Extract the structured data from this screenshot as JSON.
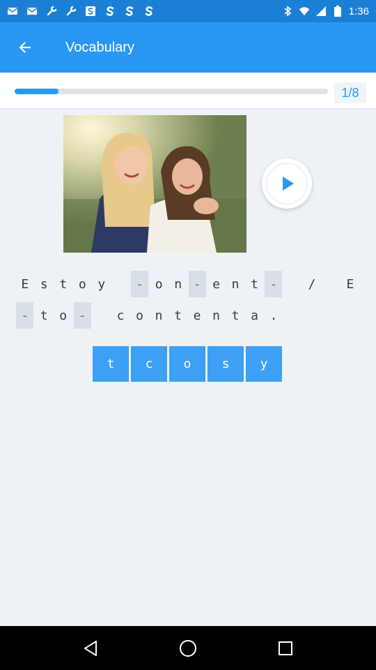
{
  "status_bar": {
    "time": "1:36",
    "icons": [
      "mail-icon",
      "mail-icon",
      "wrench-icon",
      "wrench-icon",
      "s-app-icon",
      "s-app-icon",
      "s-app-icon",
      "s-app-icon"
    ]
  },
  "app_bar": {
    "title": "Vocabulary",
    "back_icon": "arrow-back-icon"
  },
  "progress": {
    "fraction": 0.14,
    "counter": "1/8"
  },
  "media": {
    "photo_alt": "",
    "play_icon": "play-icon"
  },
  "sentence": {
    "rows": [
      [
        {
          "t": "E"
        },
        {
          "t": "s"
        },
        {
          "t": "t"
        },
        {
          "t": "o"
        },
        {
          "t": "y"
        },
        {
          "t": " "
        },
        {
          "t": "-",
          "blank": true
        },
        {
          "t": "o"
        },
        {
          "t": "n"
        },
        {
          "t": "-",
          "blank": true
        },
        {
          "t": "e"
        },
        {
          "t": "n"
        },
        {
          "t": "t"
        },
        {
          "t": "-",
          "blank": true
        },
        {
          "t": " "
        },
        {
          "t": "/"
        },
        {
          "t": " "
        },
        {
          "t": "E"
        }
      ],
      [
        {
          "t": "-",
          "blank": true
        },
        {
          "t": "t"
        },
        {
          "t": "o"
        },
        {
          "t": "-",
          "blank": true
        },
        {
          "t": " "
        },
        {
          "t": "c"
        },
        {
          "t": "o"
        },
        {
          "t": "n"
        },
        {
          "t": "t"
        },
        {
          "t": "e"
        },
        {
          "t": "n"
        },
        {
          "t": "t"
        },
        {
          "t": "a"
        },
        {
          "t": "."
        }
      ]
    ]
  },
  "answer_tiles": [
    "t",
    "c",
    "o",
    "s",
    "y"
  ],
  "colors": {
    "status_bar": "#1c7fd6",
    "app_bar": "#2a97f2",
    "accent": "#2a97f2",
    "tile": "#3da0f5",
    "background": "#eef2f6"
  },
  "nav": {
    "back": "nav-back-icon",
    "home": "nav-home-icon",
    "recents": "nav-recents-icon"
  }
}
